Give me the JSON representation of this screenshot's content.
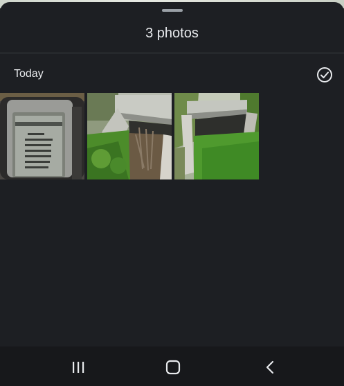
{
  "sheet": {
    "title": "3 photos"
  },
  "section": {
    "label": "Today",
    "select_icon": "check-circle-icon"
  },
  "photos": [
    {
      "icon": "photo-thumbnail-1"
    },
    {
      "icon": "photo-thumbnail-2"
    },
    {
      "icon": "photo-thumbnail-3"
    }
  ],
  "navbar": {
    "icons": [
      "recent-apps-icon",
      "home-icon",
      "back-icon"
    ]
  },
  "colors": {
    "background": "#1d1f23",
    "text": "#e8eaed",
    "divider": "#3c4043",
    "navbar": "#17181b"
  }
}
